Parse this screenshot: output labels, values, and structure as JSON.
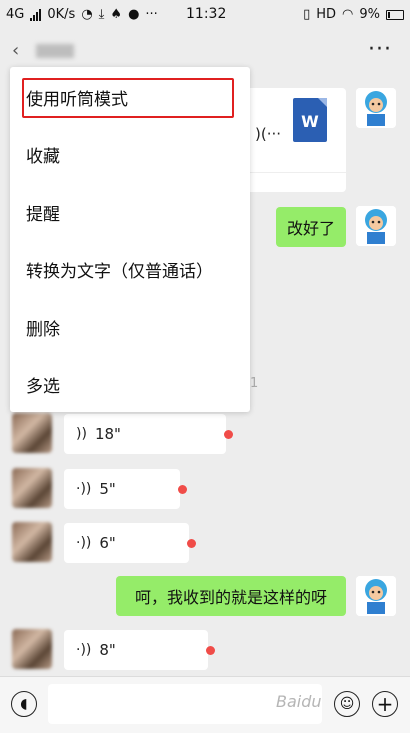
{
  "status_bar": {
    "network": "4G",
    "speed": "0K/s",
    "time": "11:32",
    "hd_label": "HD",
    "battery": "9%"
  },
  "header": {
    "back_glyph": "‹",
    "more_glyph": "···"
  },
  "file_message": {
    "snippet": ")(···",
    "icon_letter": "W"
  },
  "messages": {
    "sent_1": "改好了",
    "sent_2": "呵，我收到的就是这样的呀",
    "voice_1": "18\"",
    "voice_2": "5\"",
    "voice_3": "6\"",
    "voice_4": "8\"",
    "partial_char": "1"
  },
  "context_menu": {
    "items": [
      {
        "label": "使用听筒模式",
        "highlighted": true
      },
      {
        "label": "收藏"
      },
      {
        "label": "提醒"
      },
      {
        "label": "转换为文字（仅普通话）"
      },
      {
        "label": "删除"
      },
      {
        "label": "多选"
      }
    ]
  },
  "input_bar": {
    "voice_glyph": "◖",
    "emoji_glyph": "☺",
    "plus_glyph": "+"
  },
  "watermark": "Baidu",
  "colors": {
    "background": "#ededed",
    "sent_bubble": "#95ec69",
    "highlight_border": "#e02020",
    "unread_dot": "#f04c48",
    "word_icon": "#2b5fb3"
  }
}
